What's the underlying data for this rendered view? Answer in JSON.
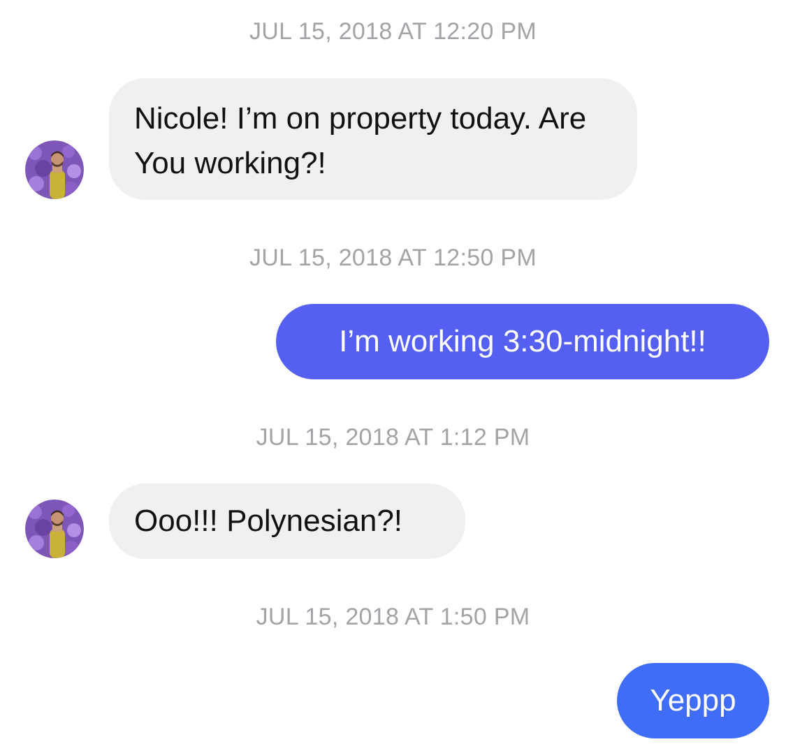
{
  "conversation": {
    "messages": [
      {
        "timestamp": "JUL 15, 2018 AT 12:20 PM",
        "direction": "incoming",
        "text": "Nicole! I’m on property today. Are You working?!"
      },
      {
        "timestamp": "JUL 15, 2018 AT 12:50 PM",
        "direction": "outgoing",
        "text": "I’m working 3:30-midnight!!",
        "bubble_color": "#5560f2"
      },
      {
        "timestamp": "JUL 15, 2018 AT 1:12 PM",
        "direction": "incoming",
        "text": "Ooo!!! Polynesian?!"
      },
      {
        "timestamp": "JUL 15, 2018 AT 1:50 PM",
        "direction": "outgoing",
        "text": "Yeppp",
        "bubble_color": "#3f6df7"
      }
    ]
  },
  "colors": {
    "incoming_bubble": "#f0f0f0",
    "incoming_text": "#111111",
    "timestamp_text": "#a3a3a8",
    "outgoing_text": "#ffffff"
  },
  "icons": {
    "avatar": "contact-avatar-photo"
  }
}
